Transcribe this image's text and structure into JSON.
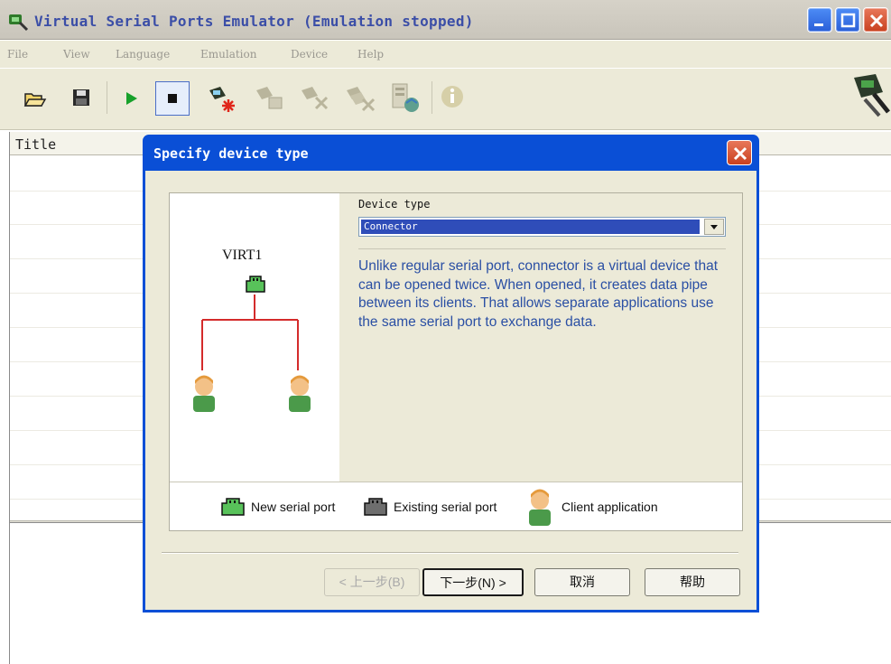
{
  "window": {
    "title": "Virtual Serial Ports Emulator (Emulation stopped)",
    "app_icon": "serial-connector-icon"
  },
  "menu": {
    "items": [
      "File",
      "View",
      "Language",
      "Emulation",
      "Device",
      "Help"
    ]
  },
  "toolbar": {
    "icons": [
      "open-folder-icon",
      "save-disk-icon",
      "play-icon",
      "stop-icon",
      "new-device-icon",
      "device-properties-icon",
      "remove-device-icon",
      "remove-all-icon",
      "reset-network-icon",
      "info-icon",
      "logo-icon"
    ]
  },
  "list": {
    "column_title": "Title"
  },
  "dialog": {
    "title": "Specify device type",
    "device_type_label": "Device type",
    "device_type_value": "Connector",
    "description": "Unlike regular serial port, connector is a virtual device that can be opened twice. When opened, it creates data pipe between its clients. That allows separate applications use the same serial port to exchange data.",
    "diagram_label": "VIRT1",
    "legend": {
      "new_port": "New serial port",
      "existing_port": "Existing serial port",
      "client": "Client application"
    },
    "buttons": {
      "back": "< 上一步(B)",
      "next": "下一步(N) >",
      "cancel": "取消",
      "help": "帮助"
    }
  },
  "colors": {
    "dialog_frame": "#0a4fd6",
    "select_highlight": "#2f4db9",
    "description_text": "#2a4fa4",
    "wire": "#d42b2b"
  }
}
